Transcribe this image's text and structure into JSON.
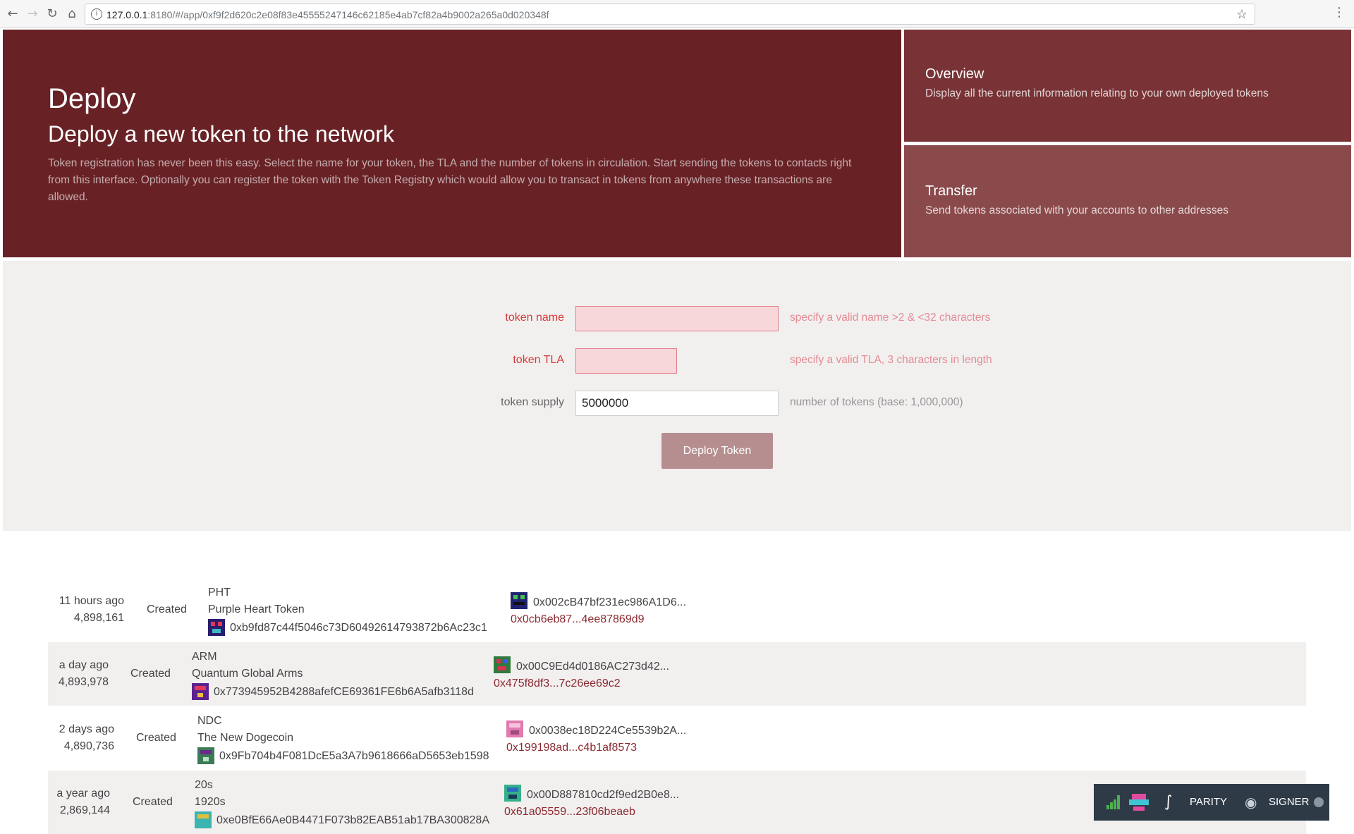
{
  "browser": {
    "url_host": "127.0.0.1",
    "url_rest": ":8180/#/app/0xf9f2d620c2e08f83e45555247146c62185e4ab7cf82a4b9002a265a0d020348f"
  },
  "hero": {
    "title": "Deploy",
    "subtitle": "Deploy a new token to the network",
    "description": "Token registration has never been this easy. Select the name for your token, the TLA and the number of tokens in circulation. Start sending the tokens to contacts right from this interface. Optionally you can register the token with the Token Registry which would allow you to transact in tokens from anywhere these transactions are allowed."
  },
  "side_panels": {
    "overview": {
      "title": "Overview",
      "description": "Display all the current information relating to your own deployed tokens"
    },
    "transfer": {
      "title": "Transfer",
      "description": "Send tokens associated with your accounts to other addresses"
    }
  },
  "form": {
    "token_name": {
      "label": "token name",
      "value": "",
      "hint": "specify a valid name >2 & <32 characters"
    },
    "token_tla": {
      "label": "token TLA",
      "value": "",
      "hint": "specify a valid TLA, 3 characters in length"
    },
    "token_supply": {
      "label": "token supply",
      "value": "5000000",
      "hint": "number of tokens (base: 1,000,000)"
    },
    "deploy_label": "Deploy Token"
  },
  "events": [
    {
      "time": "11 hours ago",
      "block": "4,898,161",
      "type": "Created",
      "tla": "PHT",
      "name": "Purple Heart Token",
      "address": "0xb9fd87c44f5046c73D60492614793872b6Ac23c1",
      "owner": "0x002cB47bf231ec986A1D6...",
      "tx": "0x0cb6eb87...4ee87869d9"
    },
    {
      "time": "a day ago",
      "block": "4,893,978",
      "type": "Created",
      "tla": "ARM",
      "name": "Quantum Global Arms",
      "address": "0x773945952B4288afefCE69361FE6b6A5afb3118d",
      "owner": "0x00C9Ed4d0186AC273d42...",
      "tx": "0x475f8df3...7c26ee69c2"
    },
    {
      "time": "2 days ago",
      "block": "4,890,736",
      "type": "Created",
      "tla": "NDC",
      "name": "The New Dogecoin",
      "address": "0x9Fb704b4F081DcE5a3A7b9618666aD5653eb1598",
      "owner": "0x0038ec18D224Ce5539b2A...",
      "tx": "0x199198ad...c4b1af8573"
    },
    {
      "time": "a year ago",
      "block": "2,869,144",
      "type": "Created",
      "tla": "20s",
      "name": "1920s",
      "address": "0xe0BfE66Ae0B4471F073b82EAB51ab17BA300828A",
      "owner": "0x00D887810cd2f9ed2B0e8...",
      "tx": "0x61a05559...23f06beaeb"
    }
  ],
  "status_bar": {
    "parity_label": "PARITY",
    "signer_label": "SIGNER"
  },
  "colors": {
    "hero_bg": "#682226",
    "overview_bg": "#793336",
    "transfer_bg": "#8a4a4c",
    "error_text": "#d83a3a",
    "deploy_button": "#b68e8f",
    "tx_link": "#8b2a30"
  },
  "icons": [
    "back-arrow-icon",
    "forward-arrow-icon",
    "reload-icon",
    "home-icon",
    "info-icon",
    "star-icon",
    "menu-dots-icon",
    "identicon",
    "signal-icon",
    "parity-logo-icon",
    "fingerprint-icon",
    "status-dot-icon"
  ]
}
